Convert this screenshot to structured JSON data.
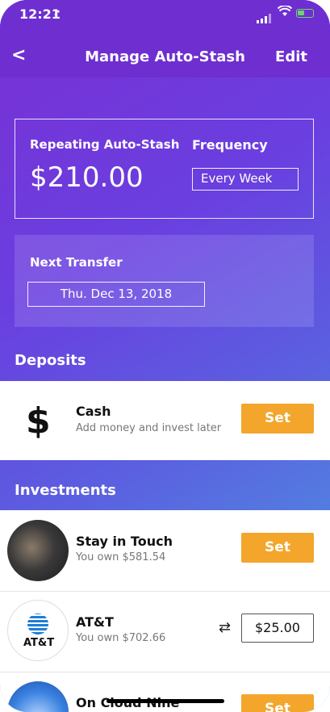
{
  "status_bar": {
    "time": "12:21",
    "location_glyph": "➚"
  },
  "nav": {
    "back_glyph": "<",
    "title": "Manage Auto-Stash",
    "edit_label": "Edit"
  },
  "auto_stash": {
    "repeating_label": "Repeating Auto-Stash",
    "amount": "$210.00",
    "frequency_label": "Frequency",
    "frequency_value": "Every Week"
  },
  "next_transfer": {
    "label": "Next Transfer",
    "date": "Thu. Dec 13, 2018"
  },
  "deposits": {
    "heading": "Deposits",
    "items": [
      {
        "title": "Cash",
        "subtitle": "Add money and invest later",
        "action": "Set",
        "icon": "dollar-icon"
      }
    ]
  },
  "investments": {
    "heading": "Investments",
    "items": [
      {
        "title": "Stay in Touch",
        "subtitle": "You own $581.54",
        "action": "Set",
        "icon": "stay-in-touch-image"
      },
      {
        "title": "AT&T",
        "subtitle": "You own $702.66",
        "amount": "$25.00",
        "logo_text": "AT&T",
        "icon": "att-logo"
      },
      {
        "title": "On Cloud Nine",
        "action": "Set",
        "icon": "on-cloud-nine-image"
      }
    ]
  },
  "colors": {
    "accent": "#f3a62b",
    "header": "#6e2ed0",
    "gradient_end": "#4aa3e0"
  }
}
